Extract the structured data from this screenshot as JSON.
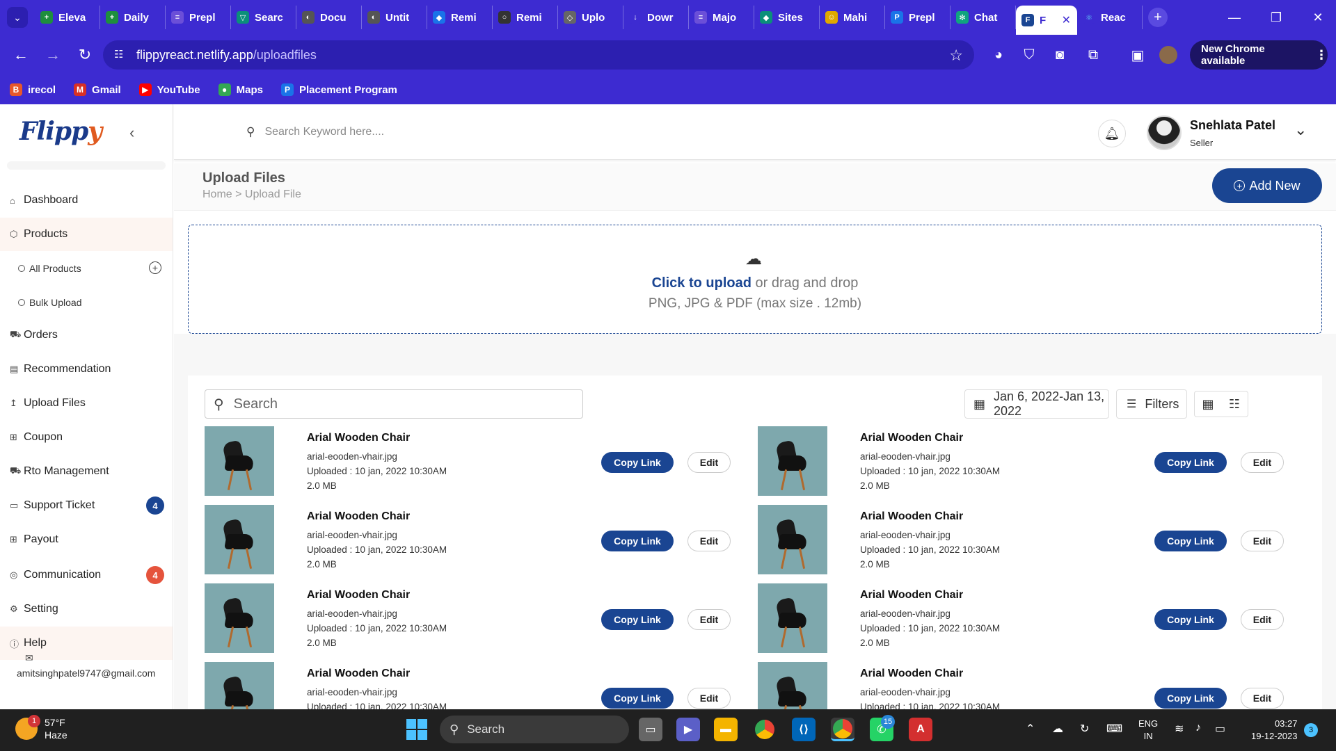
{
  "browser": {
    "tabs": [
      {
        "label": "Eleva",
        "color": "#1e8e3e",
        "glyph": "+"
      },
      {
        "label": "Daily",
        "color": "#1e8e3e",
        "glyph": "+"
      },
      {
        "label": "Prepl",
        "color": "#6b4fd8",
        "glyph": "≡"
      },
      {
        "label": "Searc",
        "color": "#0b8f7a",
        "glyph": "▽"
      },
      {
        "label": "Docu",
        "color": "#555555",
        "glyph": "◐"
      },
      {
        "label": "Untit",
        "color": "#555555",
        "glyph": "◐"
      },
      {
        "label": "Remi",
        "color": "#1a73e8",
        "glyph": "◆"
      },
      {
        "label": "Remi",
        "color": "#333333",
        "glyph": "○"
      },
      {
        "label": "Uplo",
        "color": "#666666",
        "glyph": "◇"
      },
      {
        "label": "Dowr",
        "color": "#3d2bd1",
        "glyph": "↓"
      },
      {
        "label": "Majo",
        "color": "#6b4fd8",
        "glyph": "≡"
      },
      {
        "label": "Sites",
        "color": "#0b8f7a",
        "glyph": "◆"
      },
      {
        "label": "Mahi",
        "color": "#e0a800",
        "glyph": "☺"
      },
      {
        "label": "Prepl",
        "color": "#1a73e8",
        "glyph": "P"
      },
      {
        "label": "Chat",
        "color": "#10a37f",
        "glyph": "✻"
      }
    ],
    "active_tab": {
      "label": "F",
      "close": "✕"
    },
    "after_tab": {
      "label": "Reac",
      "glyph": "⚛"
    },
    "new_tab": "+",
    "url_host": "flippyreact.netlify.app",
    "url_path": "/uploadfiles",
    "new_chrome_label": "New Chrome available",
    "bookmarks": [
      {
        "label": "irecol",
        "color": "#e8572a",
        "glyph": "B"
      },
      {
        "label": "Gmail",
        "color": "#d93025",
        "glyph": "M"
      },
      {
        "label": "YouTube",
        "color": "#ff0000",
        "glyph": "▶"
      },
      {
        "label": "Maps",
        "color": "#34a853",
        "glyph": "●"
      },
      {
        "label": "Placement Program",
        "color": "#1a73e8",
        "glyph": "P"
      }
    ]
  },
  "sidebar": {
    "logo_main": "Flipp",
    "logo_accent": "y",
    "menu": {
      "dashboard": "Dashboard",
      "products": "Products",
      "all_products": "All Products",
      "bulk_upload": "Bulk Upload",
      "orders": "Orders",
      "recommendation": "Recommendation",
      "upload_files": "Upload Files",
      "coupon": "Coupon",
      "rto": "Rto Management",
      "support": "Support Ticket",
      "payout": "Payout",
      "communication": "Communication",
      "setting": "Setting",
      "help": "Help"
    },
    "support_count": "4",
    "communication_count": "4",
    "email": "amitsinghpatel9747@gmail.com",
    "colors": {
      "support_badge": "#1a4592",
      "communication_badge": "#e5533c"
    }
  },
  "header": {
    "search_placeholder": "Search Keyword here....",
    "user_name": "Snehlata Patel",
    "user_role": "Seller"
  },
  "page": {
    "title": "Upload Files",
    "breadcrumb": "Home > Upload File",
    "add_new_label": "Add New"
  },
  "upload": {
    "click_text": "Click to upload",
    "rest_text": " or drag and drop",
    "formats": "PNG, JPG & PDF (max size . 12mb)"
  },
  "list": {
    "search_placeholder": "Search",
    "date_range": "Jan 6, 2022-Jan 13, 2022",
    "filters_label": "Filters",
    "items": [
      {
        "title": "Arial Wooden Chair",
        "file": "arial-eooden-vhair.jpg",
        "uploaded": "Uploaded : 10 jan, 2022 10:30AM",
        "size": "2.0 MB"
      },
      {
        "title": "Arial Wooden Chair",
        "file": "arial-eooden-vhair.jpg",
        "uploaded": "Uploaded : 10 jan, 2022 10:30AM",
        "size": "2.0 MB"
      },
      {
        "title": "Arial Wooden Chair",
        "file": "arial-eooden-vhair.jpg",
        "uploaded": "Uploaded : 10 jan, 2022 10:30AM",
        "size": "2.0 MB"
      },
      {
        "title": "Arial Wooden Chair",
        "file": "arial-eooden-vhair.jpg",
        "uploaded": "Uploaded : 10 jan, 2022 10:30AM",
        "size": "2.0 MB"
      },
      {
        "title": "Arial Wooden Chair",
        "file": "arial-eooden-vhair.jpg",
        "uploaded": "Uploaded : 10 jan, 2022 10:30AM",
        "size": "2.0 MB"
      },
      {
        "title": "Arial Wooden Chair",
        "file": "arial-eooden-vhair.jpg",
        "uploaded": "Uploaded : 10 jan, 2022 10:30AM",
        "size": "2.0 MB"
      },
      {
        "title": "Arial Wooden Chair",
        "file": "arial-eooden-vhair.jpg",
        "uploaded": "Uploaded : 10 jan, 2022 10:30AM",
        "size": ""
      },
      {
        "title": "Arial Wooden Chair",
        "file": "arial-eooden-vhair.jpg",
        "uploaded": "Uploaded : 10 jan, 2022 10:30AM",
        "size": ""
      }
    ],
    "copy_label": "Copy Link",
    "edit_label": "Edit"
  },
  "taskbar": {
    "temperature": "57°F",
    "weather": "Haze",
    "weather_badge": "1",
    "search_label": "Search",
    "whatsapp_badge": "15",
    "lang_top": "ENG",
    "lang_bottom": "IN",
    "time": "03:27",
    "date": "19-12-2023",
    "notifications": "3"
  }
}
